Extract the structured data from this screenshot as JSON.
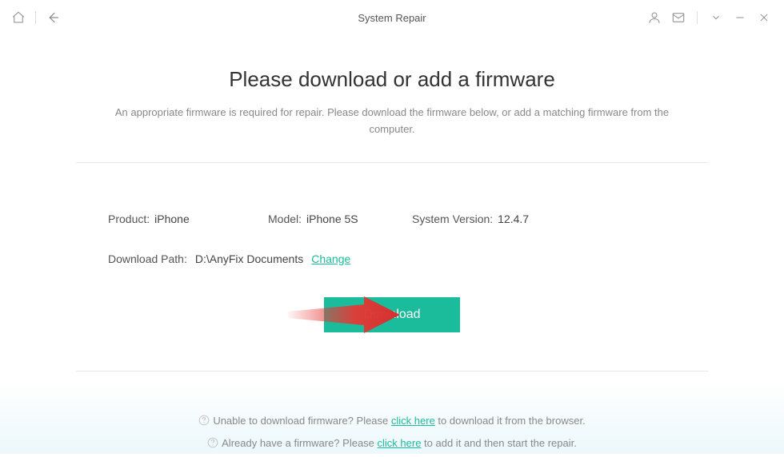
{
  "titlebar": {
    "title": "System Repair"
  },
  "heading": "Please download or add a firmware",
  "subtext": "An appropriate firmware is required for repair. Please download the firmware below, or add a matching firmware from the computer.",
  "info": {
    "product_label": "Product:",
    "product_value": "iPhone",
    "model_label": "Model:",
    "model_value": "iPhone 5S",
    "system_version_label": "System Version:",
    "system_version_value": "12.4.7",
    "download_path_label": "Download Path:",
    "download_path_value": "D:\\AnyFix Documents",
    "change_link": "Change"
  },
  "buttons": {
    "download": "Download"
  },
  "footer": {
    "line1_pre": "Unable to download firmware? Please ",
    "line1_link": "click here",
    "line1_post": " to download it from the browser.",
    "line2_pre": "Already have a firmware? Please ",
    "line2_link": "click here",
    "line2_post": " to add it and then start the repair."
  }
}
